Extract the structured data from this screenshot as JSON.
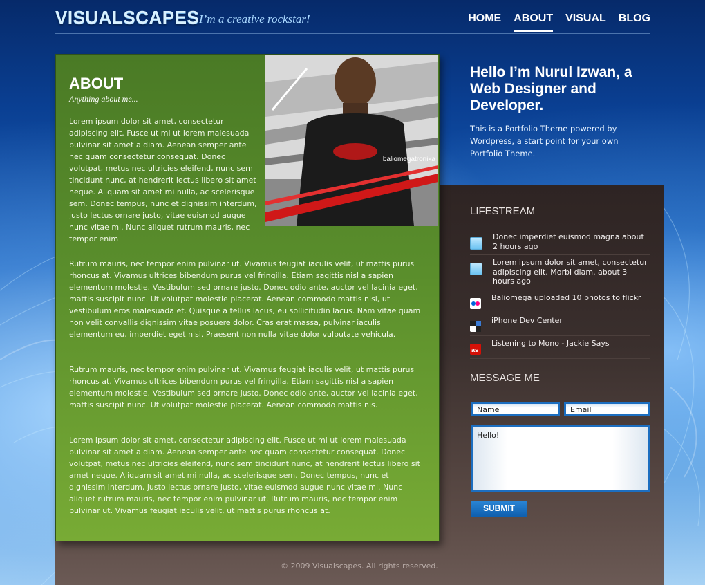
{
  "header": {
    "logo": "VISUALSCAPES",
    "tagline": "I’m a creative rockstar!",
    "nav": [
      {
        "label": "HOME",
        "active": false
      },
      {
        "label": "ABOUT",
        "active": true
      },
      {
        "label": "VISUAL",
        "active": false
      },
      {
        "label": "BLOG",
        "active": false
      }
    ]
  },
  "about": {
    "title": "ABOUT",
    "subtitle": "Anything about me...",
    "photo_caption": "baliomegatronika",
    "paragraphs": [
      "Lorem ipsum dolor sit amet, consectetur adipiscing elit. Fusce ut mi ut lorem malesuada pulvinar sit amet a diam. Aenean semper ante nec quam consectetur consequat. Donec volutpat, metus nec ultricies eleifend, nunc sem tincidunt nunc, at hendrerit lectus libero sit amet neque. Aliquam sit amet mi nulla, ac scelerisque sem. Donec tempus, nunc et dignissim interdum, justo lectus ornare justo, vitae euismod augue nunc vitae mi. Nunc aliquet rutrum mauris, nec tempor enim",
      "Rutrum mauris, nec tempor enim pulvinar ut. Vivamus feugiat iaculis velit, ut mattis purus rhoncus at. Vivamus ultrices bibendum purus vel fringilla. Etiam sagittis nisl a sapien elementum molestie. Vestibulum sed ornare justo. Donec odio ante, auctor vel lacinia eget, mattis suscipit nunc. Ut volutpat molestie placerat. Aenean commodo mattis nisi, ut vestibulum eros malesuada et. Quisque a tellus lacus, eu sollicitudin lacus. Nam vitae quam non velit convallis dignissim vitae posuere dolor. Cras erat massa, pulvinar iaculis elementum eu, imperdiet eget nisi. Praesent non nulla vitae dolor vulputate vehicula.",
      "Rutrum mauris, nec tempor enim pulvinar ut. Vivamus feugiat iaculis velit, ut mattis purus rhoncus at. Vivamus ultrices bibendum purus vel fringilla. Etiam sagittis nisl a sapien elementum molestie. Vestibulum sed ornare justo. Donec odio ante, auctor vel lacinia eget, mattis suscipit nunc. Ut volutpat molestie placerat. Aenean commodo mattis nis.",
      "Lorem ipsum dolor sit amet, consectetur adipiscing elit. Fusce ut mi ut lorem malesuada pulvinar sit amet a diam. Aenean semper ante nec quam consectetur consequat. Donec volutpat, metus nec ultricies eleifend, nunc sem tincidunt nunc, at hendrerit lectus libero sit amet neque. Aliquam sit amet mi nulla, ac scelerisque sem. Donec tempus, nunc et dignissim interdum, justo lectus ornare justo, vitae euismod augue nunc vitae mi. Nunc aliquet rutrum mauris, nec tempor enim pulvinar ut. Rutrum mauris, nec tempor enim pulvinar ut. Vivamus feugiat iaculis velit, ut mattis purus rhoncus at."
    ]
  },
  "intro": {
    "heading": "Hello I’m Nurul Izwan, a Web Designer and Developer.",
    "text": "This is a Portfolio Theme powered by Wordpress, a start point for your own Portfolio Theme."
  },
  "lifestream": {
    "title": "LIFESTREAM",
    "items": [
      {
        "icon": "twitter-icon",
        "text": "Donec imperdiet euismod magna about 2 hours ago",
        "link": ""
      },
      {
        "icon": "twitter-icon",
        "text": "Lorem ipsum dolor sit amet, consectetur adipiscing elit. Morbi diam. about 3 hours ago",
        "link": ""
      },
      {
        "icon": "flickr-icon",
        "text": "Baliomega uploaded 10 photos to ",
        "link": "flickr"
      },
      {
        "icon": "iphone-dev-icon",
        "text": "iPhone Dev Center",
        "link": ""
      },
      {
        "icon": "lastfm-icon",
        "text": "Listening to Mono - Jackie Says",
        "link": ""
      }
    ]
  },
  "message": {
    "title": "MESSAGE ME",
    "name_value": "Name",
    "email_value": "Email",
    "message_value": "Hello!",
    "submit_label": "SUBMIT"
  },
  "footer": {
    "copyright": "© 2009 Visualscapes. All rights reserved."
  },
  "colors": {
    "green_panel": "#5a8e2c",
    "brown_panel": "#3a2f2d",
    "accent_blue": "#1c6ec0",
    "lastfm_red": "#d51007"
  }
}
